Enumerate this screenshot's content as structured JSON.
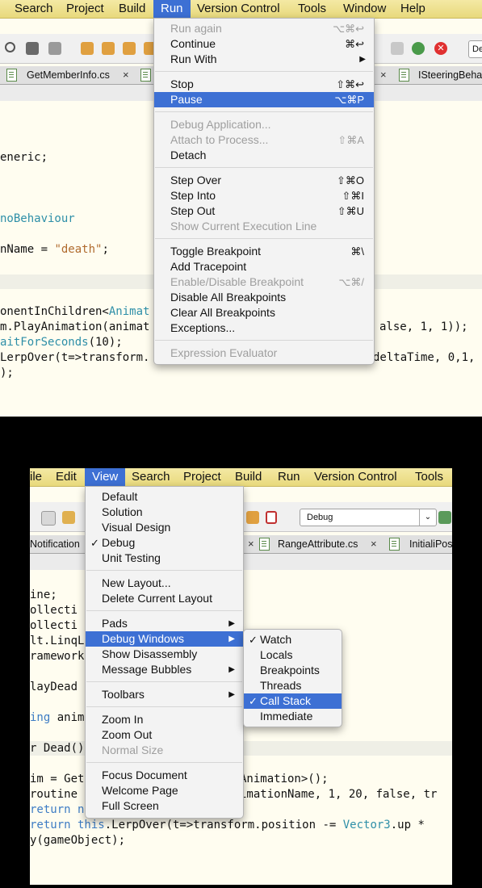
{
  "top": {
    "menubar": [
      "Search",
      "Project",
      "Build",
      "Run",
      "Version Control",
      "Tools",
      "Window",
      "Help"
    ],
    "tabs": {
      "tab1": "GetMemberInfo.cs",
      "tab2": "ISteeringBeha",
      "close": "×"
    },
    "toolbar_combo": "De",
    "code": {
      "l1": "eneric;",
      "l2a": "noBehaviour",
      "l3a": "nName = ",
      "l3b": "\"death\"",
      "l3c": ";",
      "l4a": "onentInChildren<",
      "l4b": "Animat",
      "l5a": "m.PlayAnimation(animat",
      "l5b": "alse, 1, 1));",
      "l6a": "aitForSeconds",
      "l6b": "(10);",
      "l7a": "LerpOver(t=>transform.",
      "l7b": "deltaTime, 0,1,",
      "l8": ");"
    },
    "run_menu": {
      "run_again": "Run again",
      "run_again_sc": "⌥⌘↩",
      "continue": "Continue",
      "continue_sc": "⌘↩",
      "run_with": "Run With",
      "arrow": "▶",
      "stop": "Stop",
      "stop_sc": "⇧⌘↩",
      "pause": "Pause",
      "pause_sc": "⌥⌘P",
      "debug_app": "Debug Application...",
      "attach": "Attach to Process...",
      "attach_sc": "⇧⌘A",
      "detach": "Detach",
      "step_over": "Step Over",
      "step_over_sc": "⇧⌘O",
      "step_into": "Step Into",
      "step_into_sc": "⇧⌘I",
      "step_out": "Step Out",
      "step_out_sc": "⇧⌘U",
      "show_line": "Show Current Execution Line",
      "toggle_bp": "Toggle Breakpoint",
      "toggle_bp_sc": "⌘\\",
      "add_tp": "Add Tracepoint",
      "enable_bp": "Enable/Disable Breakpoint",
      "enable_bp_sc": "⌥⌘/",
      "disable_all": "Disable All Breakpoints",
      "clear_all": "Clear All Breakpoints",
      "exceptions": "Exceptions...",
      "expr_eval": "Expression Evaluator"
    }
  },
  "bottom": {
    "menubar": [
      "ile",
      "Edit",
      "View",
      "Search",
      "Project",
      "Build",
      "Run",
      "Version Control",
      "Tools"
    ],
    "toolbar_combo": "Debug",
    "tabs": {
      "tab1": "Notification",
      "tab2": "RangeAttribute.cs",
      "tab3": "InitialiPos",
      "close": "×"
    },
    "code": {
      "l1": "ine;",
      "l2": "ollecti",
      "l3": "ollecti",
      "l4": "lt.LinqL",
      "l5": "ramework",
      "l6": "layDead",
      "l7a": "ing",
      "l7b": " anim",
      "l8": "r Dead()",
      "l9a": "im = Get",
      "l9b": "Animation>();",
      "l10a": "routine",
      "l10b": "imationName, 1, 20, false, tr",
      "l11a": "return n",
      "l12a": "return this",
      "l12b": ".LerpOver(t=>transform.position -= ",
      "l12c": "Vector3",
      "l12d": ".up *",
      "l13": "y(gameObject);"
    },
    "view_menu": {
      "default": "Default",
      "solution": "Solution",
      "visual_design": "Visual Design",
      "debug": "Debug",
      "unit_testing": "Unit Testing",
      "new_layout": "New Layout...",
      "delete_layout": "Delete Current Layout",
      "pads": "Pads",
      "debug_windows": "Debug Windows",
      "show_disassembly": "Show Disassembly",
      "message_bubbles": "Message Bubbles",
      "toolbars": "Toolbars",
      "zoom_in": "Zoom In",
      "zoom_out": "Zoom Out",
      "normal_size": "Normal Size",
      "focus_doc": "Focus Document",
      "welcome": "Welcome Page",
      "full_screen": "Full Screen",
      "arrow": "▶",
      "check": "✓"
    },
    "debug_windows_menu": {
      "watch": "Watch",
      "locals": "Locals",
      "breakpoints": "Breakpoints",
      "threads": "Threads",
      "call_stack": "Call Stack",
      "immediate": "Immediate",
      "check": "✓"
    }
  }
}
